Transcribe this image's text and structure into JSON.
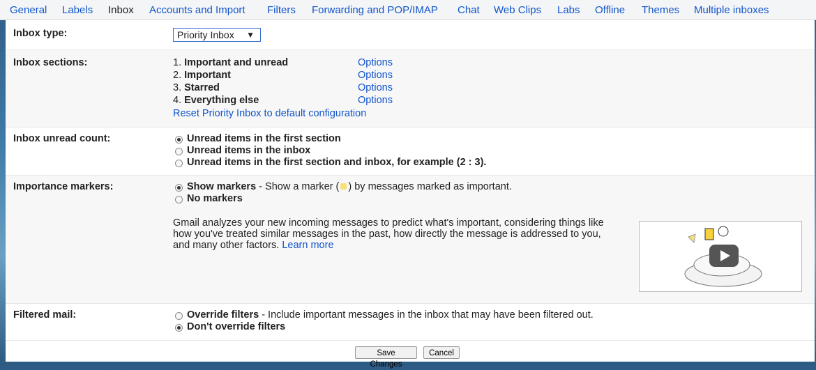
{
  "tabs": [
    {
      "label": "General"
    },
    {
      "label": "Labels"
    },
    {
      "label": "Inbox"
    },
    {
      "label": "Accounts and Import"
    },
    {
      "label": "Filters"
    },
    {
      "label": "Forwarding and POP/IMAP"
    },
    {
      "label": "Chat"
    },
    {
      "label": "Web Clips"
    },
    {
      "label": "Labs"
    },
    {
      "label": "Offline"
    },
    {
      "label": "Themes"
    },
    {
      "label": "Multiple inboxes"
    }
  ],
  "inbox_type": {
    "label": "Inbox type:",
    "value": "Priority Inbox"
  },
  "inbox_sections": {
    "label": "Inbox sections:",
    "items": [
      {
        "num": "1.",
        "name": "Important and unread",
        "options": "Options"
      },
      {
        "num": "2.",
        "name": "Important",
        "options": "Options"
      },
      {
        "num": "3.",
        "name": "Starred",
        "options": "Options"
      },
      {
        "num": "4.",
        "name": "Everything else",
        "options": "Options"
      }
    ],
    "reset_link": "Reset Priority Inbox to default configuration"
  },
  "unread_count": {
    "label": "Inbox unread count:",
    "options": [
      {
        "text": "Unread items in the first section",
        "selected": true
      },
      {
        "text": "Unread items in the inbox",
        "selected": false
      },
      {
        "text": "Unread items in the first section and inbox, for example (2 : 3).",
        "selected": false
      }
    ]
  },
  "importance_markers": {
    "label": "Importance markers:",
    "show": "Show markers",
    "show_desc_1": " - Show a marker (",
    "show_desc_2": ") by messages marked as important.",
    "no": "No markers",
    "description": "Gmail analyzes your new incoming messages to predict what's important, considering things like how you've treated similar messages in the past, how directly the message is addressed to you, and many other factors.",
    "learn_more": "Learn more"
  },
  "filtered_mail": {
    "label": "Filtered mail:",
    "override": "Override filters",
    "override_desc": " - Include important messages in the inbox that may have been filtered out.",
    "dont_override": "Don't override filters"
  },
  "buttons": {
    "save": "Save Changes",
    "cancel": "Cancel"
  },
  "colors": {
    "link": "#1155cc"
  }
}
